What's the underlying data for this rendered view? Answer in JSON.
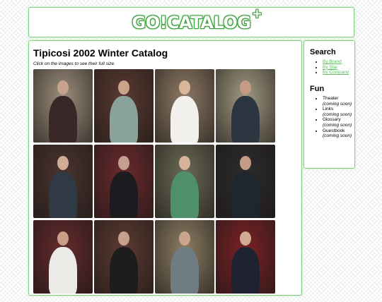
{
  "header": {
    "logo_text": "GO!CATALOG",
    "logo_plus": "+"
  },
  "main": {
    "title": "Tipicosi 2002 Winter Catalog",
    "intro": "Click on the images to see their full size.",
    "thumbnails": [
      {
        "name": "thumb-1",
        "bg": "#9c8f7c",
        "fig": "#3a2828",
        "head": "#c7a28c"
      },
      {
        "name": "thumb-2",
        "bg": "#5a3a32",
        "fig": "#8aa39a",
        "head": "#c9a38a"
      },
      {
        "name": "thumb-3",
        "bg": "#8e7a64",
        "fig": "#f1f0ec",
        "head": "#d8b79b"
      },
      {
        "name": "thumb-4",
        "bg": "#a29a82",
        "fig": "#2c3640",
        "head": "#c49c86"
      },
      {
        "name": "thumb-5",
        "bg": "#4b3430",
        "fig": "#2f3a44",
        "head": "#d0ae96"
      },
      {
        "name": "thumb-6",
        "bg": "#6a2a2e",
        "fig": "#1b1b20",
        "head": "#c6a08c"
      },
      {
        "name": "thumb-7",
        "bg": "#6b6a56",
        "fig": "#4f8f6a",
        "head": "#d7b39c"
      },
      {
        "name": "thumb-8",
        "bg": "#2d2b2c",
        "fig": "#1e2630",
        "head": "#c49b85"
      },
      {
        "name": "thumb-9",
        "bg": "#642a2d",
        "fig": "#eceae7",
        "head": "#c99f8a"
      },
      {
        "name": "thumb-10",
        "bg": "#5c3b33",
        "fig": "#1e1c1c",
        "head": "#c5a08b"
      },
      {
        "name": "thumb-11",
        "bg": "#8d7e64",
        "fig": "#6f7d82",
        "head": "#caa48c"
      },
      {
        "name": "thumb-12",
        "bg": "#7a2226",
        "fig": "#1f2230",
        "head": "#d1aa94"
      }
    ]
  },
  "sidebar": {
    "search_heading": "Search",
    "search_links": [
      "By Brand",
      "By Star",
      "By Company"
    ],
    "fun_heading": "Fun",
    "fun_items": [
      {
        "label": "Theater",
        "note": "(coming soon)"
      },
      {
        "label": "Links",
        "note": "(coming soon)"
      },
      {
        "label": "Glossary",
        "note": "(coming soon)"
      },
      {
        "label": "Guestbook",
        "note": "(coming soon)"
      }
    ]
  }
}
